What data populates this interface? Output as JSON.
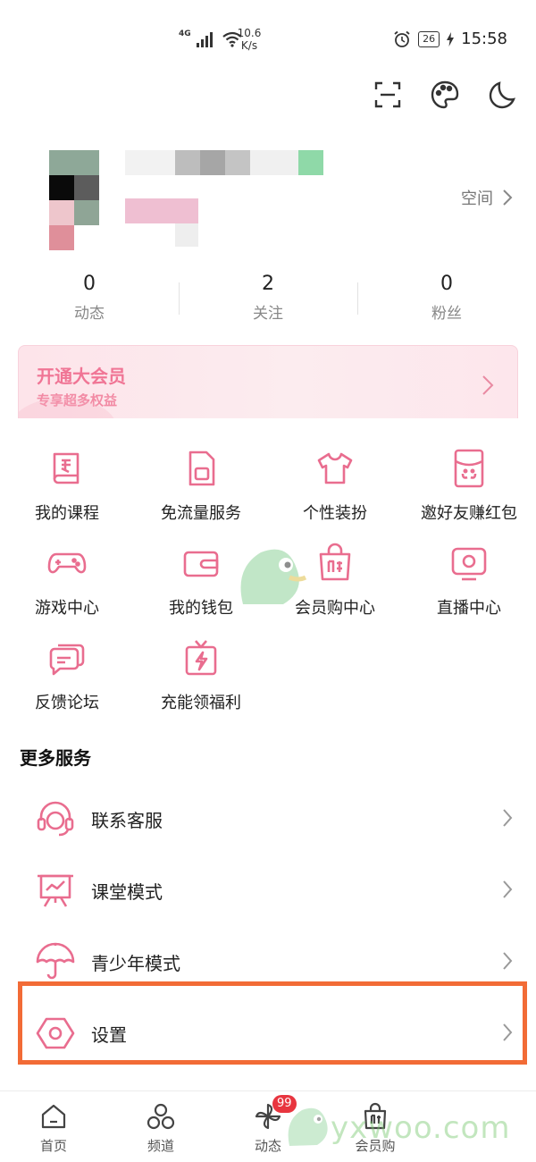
{
  "status_bar": {
    "network": "4G",
    "speed_value": "10.6",
    "speed_unit": "K/s",
    "battery": "26",
    "time": "15:58"
  },
  "top_actions": [
    {
      "name": "scan",
      "icon": "scan-icon"
    },
    {
      "name": "theme",
      "icon": "palette-icon"
    },
    {
      "name": "night-mode",
      "icon": "moon-icon"
    }
  ],
  "profile": {
    "space_link": "空间"
  },
  "stats": [
    {
      "value": "0",
      "label": "动态"
    },
    {
      "value": "2",
      "label": "关注"
    },
    {
      "value": "0",
      "label": "粉丝"
    }
  ],
  "vip_banner": {
    "title": "开通大会员",
    "subtitle": "专享超多权益"
  },
  "grid": [
    {
      "label": "我的课程",
      "icon": "course-book-icon"
    },
    {
      "label": "免流量服务",
      "icon": "sim-card-icon"
    },
    {
      "label": "个性装扮",
      "icon": "tshirt-icon"
    },
    {
      "label": "邀好友赚红包",
      "icon": "red-envelope-icon"
    },
    {
      "label": "游戏中心",
      "icon": "gamepad-icon"
    },
    {
      "label": "我的钱包",
      "icon": "wallet-icon"
    },
    {
      "label": "会员购中心",
      "icon": "shopping-bag-icon"
    },
    {
      "label": "直播中心",
      "icon": "tv-icon"
    },
    {
      "label": "反馈论坛",
      "icon": "chat-bubble-icon"
    },
    {
      "label": "充能领福利",
      "icon": "gift-lightning-icon"
    }
  ],
  "more_services": {
    "title": "更多服务",
    "items": [
      {
        "label": "联系客服",
        "icon": "headset-icon"
      },
      {
        "label": "课堂模式",
        "icon": "presentation-board-icon"
      },
      {
        "label": "青少年模式",
        "icon": "umbrella-icon"
      },
      {
        "label": "设置",
        "icon": "settings-hexagon-icon"
      }
    ]
  },
  "bottom_nav": [
    {
      "label": "首页",
      "icon": "home-icon"
    },
    {
      "label": "频道",
      "icon": "channels-icon"
    },
    {
      "label": "动态",
      "icon": "pinwheel-icon",
      "badge": "99"
    },
    {
      "label": "会员购",
      "icon": "shopping-bag-icon"
    },
    {
      "label": "",
      "icon": ""
    }
  ],
  "watermark": "yxwoo.com",
  "colors": {
    "accent_pink": "#f07595",
    "icon_pink": "#e96d8f",
    "highlight_orange": "#f26b36",
    "badge_red": "#e8353f"
  }
}
